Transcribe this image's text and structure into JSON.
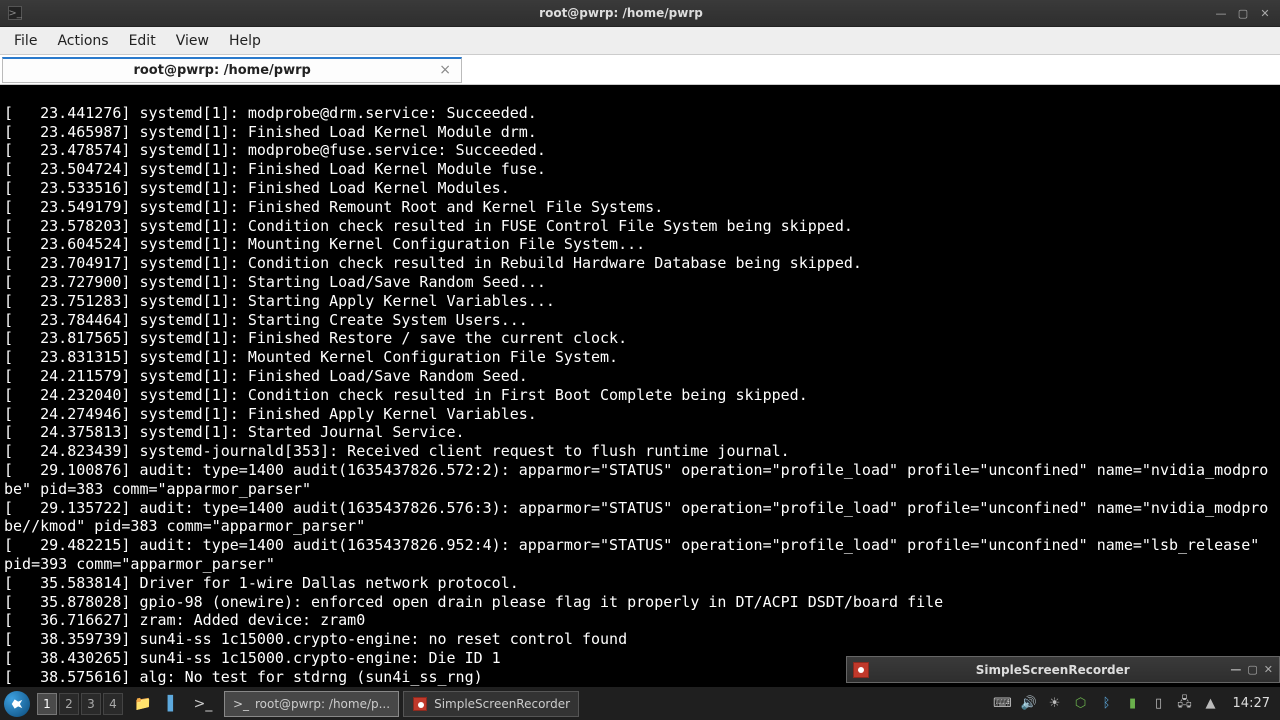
{
  "window": {
    "title": "root@pwrp: /home/pwrp"
  },
  "menu": {
    "file": "File",
    "actions": "Actions",
    "edit": "Edit",
    "view": "View",
    "help": "Help"
  },
  "tab": {
    "label": "root@pwrp: /home/pwrp"
  },
  "terminal_lines": [
    "[   23.441276] systemd[1]: modprobe@drm.service: Succeeded.",
    "[   23.465987] systemd[1]: Finished Load Kernel Module drm.",
    "[   23.478574] systemd[1]: modprobe@fuse.service: Succeeded.",
    "[   23.504724] systemd[1]: Finished Load Kernel Module fuse.",
    "[   23.533516] systemd[1]: Finished Load Kernel Modules.",
    "[   23.549179] systemd[1]: Finished Remount Root and Kernel File Systems.",
    "[   23.578203] systemd[1]: Condition check resulted in FUSE Control File System being skipped.",
    "[   23.604524] systemd[1]: Mounting Kernel Configuration File System...",
    "[   23.704917] systemd[1]: Condition check resulted in Rebuild Hardware Database being skipped.",
    "[   23.727900] systemd[1]: Starting Load/Save Random Seed...",
    "[   23.751283] systemd[1]: Starting Apply Kernel Variables...",
    "[   23.784464] systemd[1]: Starting Create System Users...",
    "[   23.817565] systemd[1]: Finished Restore / save the current clock.",
    "[   23.831315] systemd[1]: Mounted Kernel Configuration File System.",
    "[   24.211579] systemd[1]: Finished Load/Save Random Seed.",
    "[   24.232040] systemd[1]: Condition check resulted in First Boot Complete being skipped.",
    "[   24.274946] systemd[1]: Finished Apply Kernel Variables.",
    "[   24.375813] systemd[1]: Started Journal Service.",
    "[   24.823439] systemd-journald[353]: Received client request to flush runtime journal.",
    "[   29.100876] audit: type=1400 audit(1635437826.572:2): apparmor=\"STATUS\" operation=\"profile_load\" profile=\"unconfined\" name=\"nvidia_modprobe\" pid=383 comm=\"apparmor_parser\"",
    "[   29.135722] audit: type=1400 audit(1635437826.576:3): apparmor=\"STATUS\" operation=\"profile_load\" profile=\"unconfined\" name=\"nvidia_modprobe//kmod\" pid=383 comm=\"apparmor_parser\"",
    "[   29.482215] audit: type=1400 audit(1635437826.952:4): apparmor=\"STATUS\" operation=\"profile_load\" profile=\"unconfined\" name=\"lsb_release\" pid=393 comm=\"apparmor_parser\"",
    "[   35.583814] Driver for 1-wire Dallas network protocol.",
    "[   35.878028] gpio-98 (onewire): enforced open drain please flag it properly in DT/ACPI DSDT/board file",
    "[   36.716627] zram: Added device: zram0",
    "[   38.359739] sun4i-ss 1c15000.crypto-engine: no reset control found",
    "[   38.430265] sun4i-ss 1c15000.crypto-engine: Die ID 1",
    "[   38.575616] alg: No test for stdrng (sun4i_ss_rng)"
  ],
  "ssr": {
    "title": "SimpleScreenRecorder"
  },
  "taskbar": {
    "workspaces": [
      "1",
      "2",
      "3",
      "4"
    ],
    "task1": "root@pwrp: /home/p...",
    "task2": "SimpleScreenRecorder",
    "clock": "14:27"
  }
}
